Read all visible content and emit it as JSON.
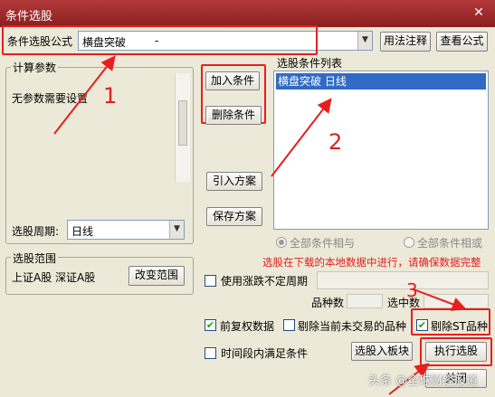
{
  "window": {
    "title": "条件选股",
    "close": "✕"
  },
  "formula": {
    "label": "条件选股公式",
    "value": "横盘突破",
    "suffix": "-",
    "usage_button": "用法注释",
    "view_button": "查看公式"
  },
  "params": {
    "group_label": "计算参数",
    "none_text": "无参数需要设置"
  },
  "period": {
    "label": "选股周期:",
    "value": "日线"
  },
  "range": {
    "group_label": "选股范围",
    "value": "上证A股 深证A股",
    "change_button": "改变范围"
  },
  "list": {
    "label": "选股条件列表",
    "items": [
      "横盘突破    日线"
    ]
  },
  "buttons": {
    "add": "加入条件",
    "delete": "删除条件",
    "import": "引入方案",
    "save": "保存方案",
    "to_block": "选股入板块",
    "execute": "执行选股",
    "close": "关闭"
  },
  "logic": {
    "and_label": "全部条件相与",
    "or_label": "全部条件相或"
  },
  "notice": "选股在下载的本地数据中进行，请确保数据完整",
  "options": {
    "unfixed_period": {
      "label": "使用涨跌不定周期",
      "checked": false
    },
    "count_label": "品种数",
    "selected_label": "选中数",
    "forward_adjust": {
      "label": "前复权数据",
      "checked": true
    },
    "exclude_untraded": {
      "label": "剔除当前未交易的品种",
      "checked": false
    },
    "exclude_st": {
      "label": "剔除ST品种",
      "checked": true
    },
    "within_period": {
      "label": "时间段内满足条件",
      "checked": false
    }
  },
  "annotations": {
    "n1": "1",
    "n2": "2",
    "n3": "3"
  },
  "watermark": "头条 @全球财经股道",
  "colors": {
    "annotation_red": "#e81e1e",
    "titlebar": "#a22d2d",
    "selection_blue": "#316ac5"
  }
}
